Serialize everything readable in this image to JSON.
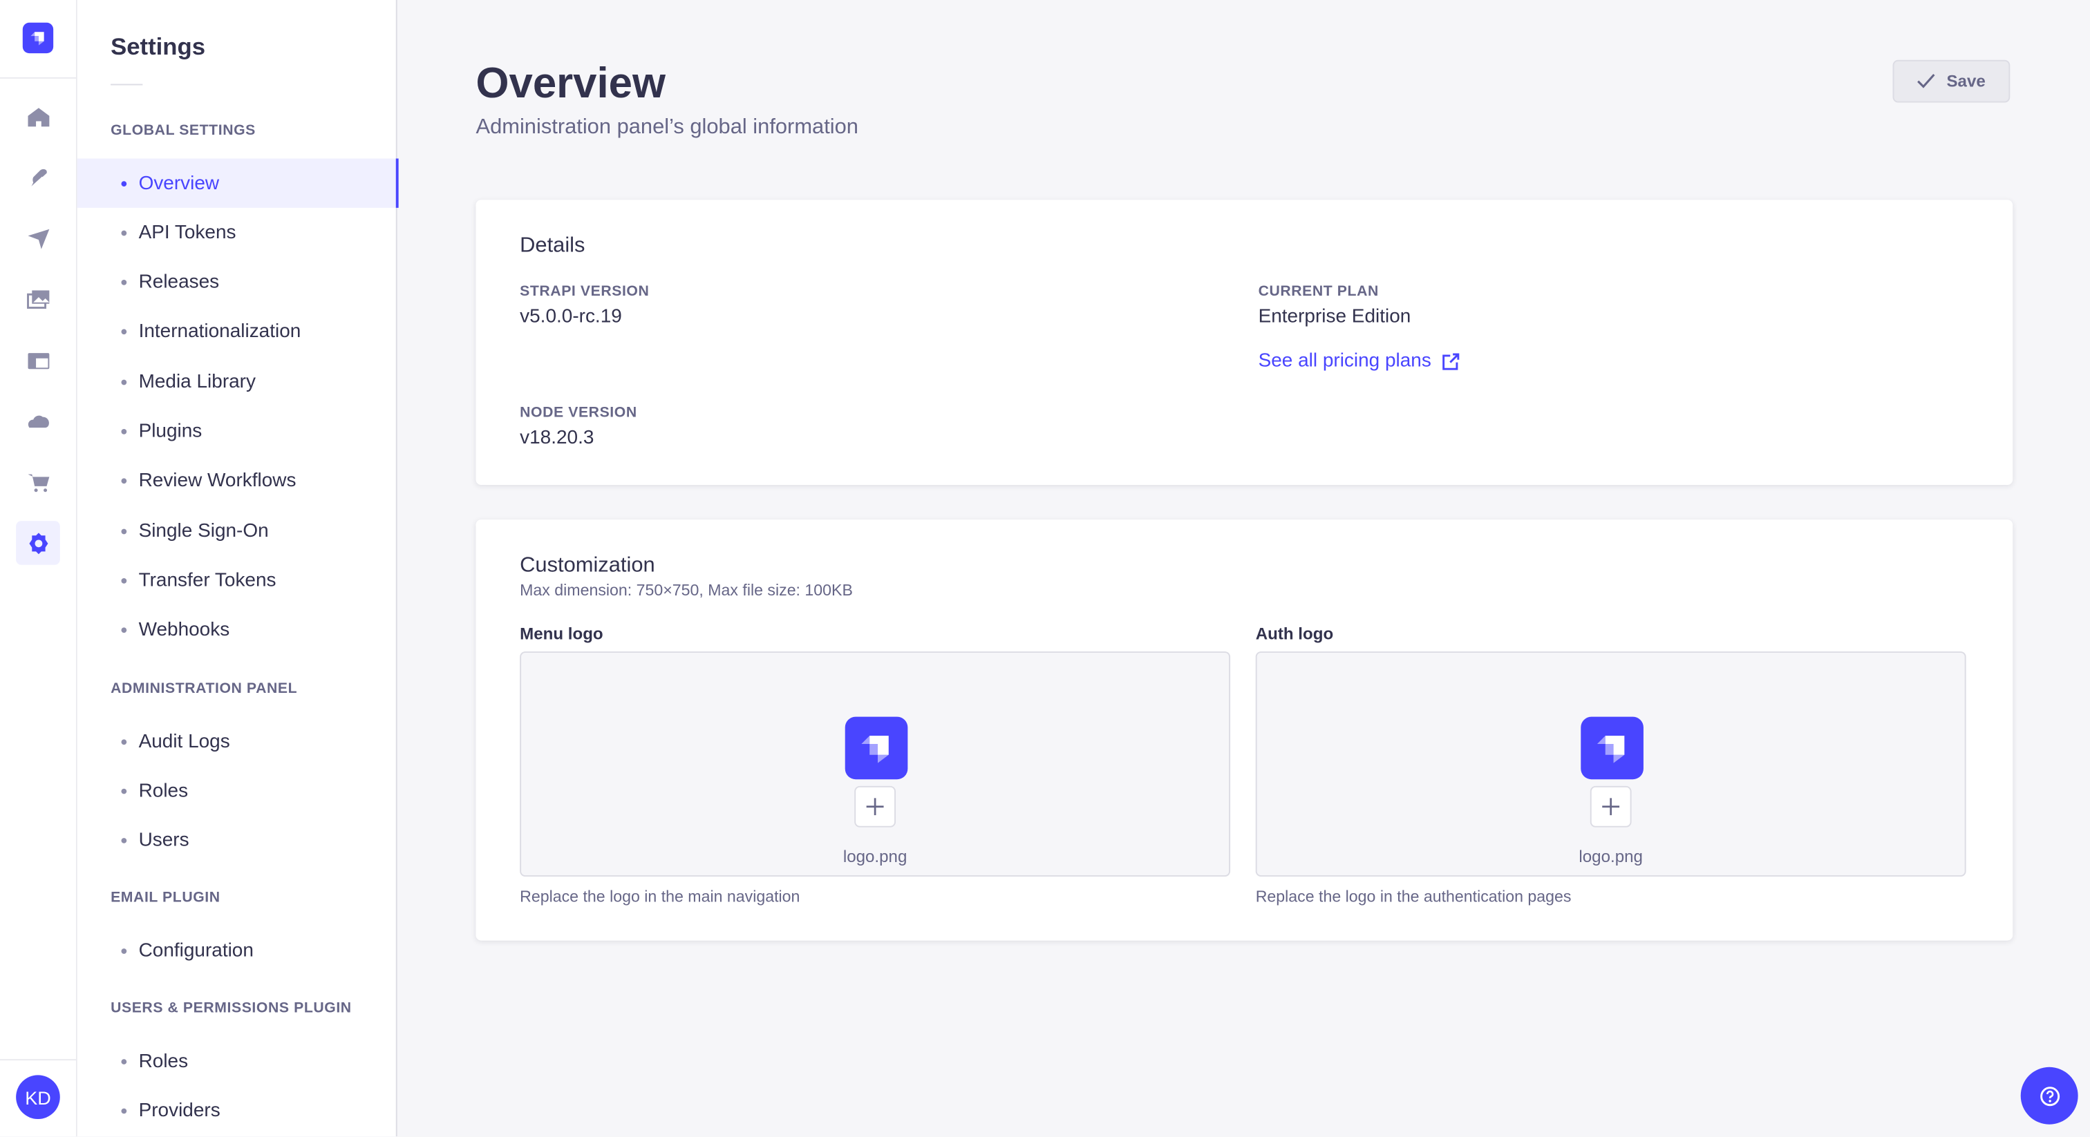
{
  "colors": {
    "accent": "#4945ff",
    "text": "#32324d",
    "muted": "#666687",
    "background": "#f6f6f9"
  },
  "nav": {
    "icons": [
      "home-icon",
      "feather-icon",
      "paper-plane-icon",
      "images-icon",
      "layout-icon",
      "cloud-icon",
      "cart-icon",
      "gear-icon"
    ],
    "active": "gear-icon",
    "avatar": "KD"
  },
  "sidebar": {
    "title": "Settings",
    "sections": [
      {
        "label": "GLOBAL SETTINGS",
        "items": [
          "Overview",
          "API Tokens",
          "Releases",
          "Internationalization",
          "Media Library",
          "Plugins",
          "Review Workflows",
          "Single Sign-On",
          "Transfer Tokens",
          "Webhooks"
        ]
      },
      {
        "label": "ADMINISTRATION PANEL",
        "items": [
          "Audit Logs",
          "Roles",
          "Users"
        ]
      },
      {
        "label": "EMAIL PLUGIN",
        "items": [
          "Configuration"
        ]
      },
      {
        "label": "USERS & PERMISSIONS PLUGIN",
        "items": [
          "Roles",
          "Providers"
        ]
      }
    ],
    "active": "Overview"
  },
  "header": {
    "title": "Overview",
    "subtitle": "Administration panel’s global information",
    "save_label": "Save"
  },
  "details": {
    "title": "Details",
    "strapi_version_label": "STRAPI VERSION",
    "strapi_version": "v5.0.0-rc.19",
    "current_plan_label": "CURRENT PLAN",
    "current_plan": "Enterprise Edition",
    "pricing_link": "See all pricing plans",
    "node_version_label": "NODE VERSION",
    "node_version": "v18.20.3"
  },
  "customization": {
    "title": "Customization",
    "hint": "Max dimension: 750×750, Max file size: 100KB",
    "menu_logo": {
      "label": "Menu logo",
      "file": "logo.png",
      "help": "Replace the logo in the main navigation"
    },
    "auth_logo": {
      "label": "Auth logo",
      "file": "logo.png",
      "help": "Replace the logo in the authentication pages"
    }
  }
}
